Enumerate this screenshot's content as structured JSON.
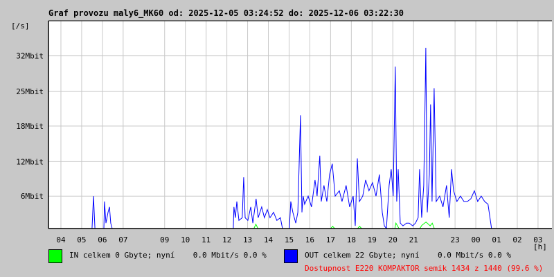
{
  "chart_data": {
    "type": "line",
    "title": "Graf provozu maly6_MK60 od: 2025-12-05 03:24:52 do: 2025-12-06 03:22:30",
    "ylabel": "[/s]",
    "xlabel": "[h]",
    "xlim": [
      3.4,
      27.67
    ],
    "ylim": [
      0,
      38.5
    ],
    "grid": true,
    "y_ticks": [
      {
        "v": 6,
        "label": "6Mbit"
      },
      {
        "v": 12.4,
        "label": "12Mbit"
      },
      {
        "v": 19,
        "label": "18Mbit"
      },
      {
        "v": 25.4,
        "label": "25Mbit"
      },
      {
        "v": 32,
        "label": "32Mbit"
      }
    ],
    "x_ticks": [
      {
        "h": 4,
        "label": "04"
      },
      {
        "h": 5,
        "label": "05"
      },
      {
        "h": 6,
        "label": "06"
      },
      {
        "h": 7,
        "label": "07"
      },
      {
        "h": 9,
        "label": "09"
      },
      {
        "h": 10,
        "label": "10"
      },
      {
        "h": 11,
        "label": "11"
      },
      {
        "h": 12,
        "label": "12"
      },
      {
        "h": 13,
        "label": "13"
      },
      {
        "h": 14,
        "label": "14"
      },
      {
        "h": 15,
        "label": "15"
      },
      {
        "h": 16,
        "label": "16"
      },
      {
        "h": 17,
        "label": "17"
      },
      {
        "h": 18,
        "label": "18"
      },
      {
        "h": 19,
        "label": "19"
      },
      {
        "h": 20,
        "label": "20"
      },
      {
        "h": 21,
        "label": "21"
      },
      {
        "h": 23,
        "label": "23"
      },
      {
        "h": 24,
        "label": "00"
      },
      {
        "h": 25,
        "label": "01"
      },
      {
        "h": 26,
        "label": "02"
      },
      {
        "h": 27,
        "label": "03"
      }
    ],
    "series": [
      {
        "name": "OUT",
        "color": "#0000ff",
        "points": [
          [
            3.4,
            0
          ],
          [
            5.5,
            0
          ],
          [
            5.57,
            6
          ],
          [
            5.64,
            0
          ],
          [
            6.07,
            0
          ],
          [
            6.1,
            5
          ],
          [
            6.17,
            1
          ],
          [
            6.27,
            3
          ],
          [
            6.34,
            4
          ],
          [
            6.4,
            1
          ],
          [
            6.47,
            0
          ],
          [
            11.74,
            0
          ],
          [
            12.31,
            0
          ],
          [
            12.34,
            4
          ],
          [
            12.41,
            2
          ],
          [
            12.48,
            5
          ],
          [
            12.58,
            1.5
          ],
          [
            12.74,
            2
          ],
          [
            12.81,
            9.5
          ],
          [
            12.88,
            2
          ],
          [
            13.01,
            1.5
          ],
          [
            13.15,
            4
          ],
          [
            13.25,
            1
          ],
          [
            13.41,
            5.5
          ],
          [
            13.51,
            2
          ],
          [
            13.68,
            4
          ],
          [
            13.81,
            2
          ],
          [
            13.95,
            3.5
          ],
          [
            14.08,
            2
          ],
          [
            14.25,
            3
          ],
          [
            14.41,
            1.5
          ],
          [
            14.58,
            2
          ],
          [
            14.68,
            0
          ],
          [
            15.01,
            0
          ],
          [
            15.08,
            5
          ],
          [
            15.18,
            3
          ],
          [
            15.32,
            1
          ],
          [
            15.42,
            3
          ],
          [
            15.55,
            21
          ],
          [
            15.62,
            3
          ],
          [
            15.68,
            6
          ],
          [
            15.75,
            4.5
          ],
          [
            15.92,
            6
          ],
          [
            16.08,
            4
          ],
          [
            16.25,
            9
          ],
          [
            16.35,
            6
          ],
          [
            16.48,
            13.5
          ],
          [
            16.55,
            5
          ],
          [
            16.68,
            8
          ],
          [
            16.82,
            5
          ],
          [
            16.95,
            10
          ],
          [
            17.08,
            12
          ],
          [
            17.22,
            6
          ],
          [
            17.42,
            7
          ],
          [
            17.55,
            5
          ],
          [
            17.75,
            8
          ],
          [
            17.92,
            4
          ],
          [
            18.09,
            6
          ],
          [
            18.19,
            0.5
          ],
          [
            18.29,
            13
          ],
          [
            18.39,
            5
          ],
          [
            18.55,
            6
          ],
          [
            18.69,
            9
          ],
          [
            18.85,
            7
          ],
          [
            19.02,
            8.5
          ],
          [
            19.19,
            6
          ],
          [
            19.35,
            10
          ],
          [
            19.49,
            3
          ],
          [
            19.59,
            0.5
          ],
          [
            19.69,
            0
          ],
          [
            19.82,
            8
          ],
          [
            19.92,
            11
          ],
          [
            20.02,
            6
          ],
          [
            20.12,
            30
          ],
          [
            20.19,
            5
          ],
          [
            20.26,
            11
          ],
          [
            20.36,
            1
          ],
          [
            20.49,
            0.5
          ],
          [
            20.66,
            1
          ],
          [
            20.79,
            1
          ],
          [
            20.96,
            0.5
          ],
          [
            21.09,
            1
          ],
          [
            21.22,
            2
          ],
          [
            21.29,
            11
          ],
          [
            21.39,
            2
          ],
          [
            21.49,
            8
          ],
          [
            21.56,
            25
          ],
          [
            21.59,
            33.5
          ],
          [
            21.66,
            3
          ],
          [
            21.76,
            10
          ],
          [
            21.82,
            23
          ],
          [
            21.89,
            5
          ],
          [
            21.99,
            26
          ],
          [
            22.09,
            5
          ],
          [
            22.26,
            6
          ],
          [
            22.42,
            4
          ],
          [
            22.59,
            8
          ],
          [
            22.72,
            2
          ],
          [
            22.83,
            11
          ],
          [
            22.93,
            7
          ],
          [
            23.09,
            5
          ],
          [
            23.26,
            6
          ],
          [
            23.43,
            5
          ],
          [
            23.59,
            5
          ],
          [
            23.76,
            5.5
          ],
          [
            23.93,
            7
          ],
          [
            24.09,
            5
          ],
          [
            24.26,
            6
          ],
          [
            24.43,
            5
          ],
          [
            24.59,
            4.5
          ],
          [
            24.76,
            0
          ],
          [
            27.67,
            0
          ]
        ]
      },
      {
        "name": "IN",
        "color": "#00ff00",
        "points": [
          [
            3.4,
            0
          ],
          [
            13.3,
            0
          ],
          [
            13.4,
            0.8
          ],
          [
            13.5,
            0
          ],
          [
            17.0,
            0
          ],
          [
            17.1,
            0.4
          ],
          [
            17.2,
            0
          ],
          [
            18.3,
            0
          ],
          [
            18.4,
            0.4
          ],
          [
            18.5,
            0
          ],
          [
            20.1,
            0
          ],
          [
            20.15,
            1
          ],
          [
            20.3,
            0
          ],
          [
            21.3,
            0
          ],
          [
            21.4,
            0.6
          ],
          [
            21.6,
            1.2
          ],
          [
            21.8,
            0.5
          ],
          [
            21.9,
            1
          ],
          [
            22.0,
            0
          ],
          [
            27.67,
            0
          ]
        ]
      }
    ]
  },
  "legend": {
    "in_text": "IN celkem 0 Gbyte; nyní    0.0 Mbit/s 0.0 %",
    "out_text": "OUT celkem 22 Gbyte; nyní    0.0 Mbit/s 0.0 %",
    "availability": "Dostupnost E220 KOMPAKTOR semik 1434 z 1440 (99.6 %)",
    "in_color": "#00ff00",
    "out_color": "#0000ff",
    "availability_color": "#ff0000"
  }
}
